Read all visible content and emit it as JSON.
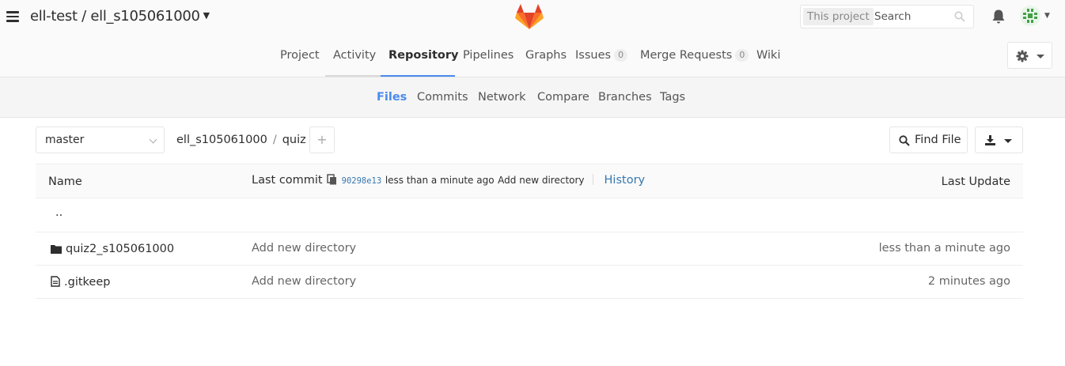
{
  "header": {
    "project_path": "ell-test / ell_s105061000",
    "search": {
      "scope": "This project",
      "placeholder": "Search"
    }
  },
  "nav": {
    "items": [
      {
        "label": "Project"
      },
      {
        "label": "Activity"
      },
      {
        "label": "Repository"
      },
      {
        "label": "Pipelines"
      },
      {
        "label": "Graphs"
      },
      {
        "label": "Issues",
        "count": "0"
      },
      {
        "label": "Merge Requests",
        "count": "0"
      },
      {
        "label": "Wiki"
      }
    ],
    "active": "Repository"
  },
  "subnav": {
    "items": [
      "Files",
      "Commits",
      "Network",
      "Compare",
      "Branches",
      "Tags"
    ],
    "active": "Files"
  },
  "controls": {
    "branch": "master",
    "breadcrumb": [
      "ell_s105061000",
      "quiz"
    ],
    "find_file": "Find File"
  },
  "table": {
    "headers": {
      "name": "Name",
      "last_commit": "Last commit",
      "last_update": "Last Update"
    },
    "commit": {
      "sha": "90298e13",
      "time": "less than a minute ago",
      "message": "Add new directory",
      "history": "History"
    },
    "parent_dir": "..",
    "rows": [
      {
        "type": "folder",
        "name": "quiz2_s105061000",
        "message": "Add new directory",
        "updated": "less than a minute ago"
      },
      {
        "type": "file",
        "name": ".gitkeep",
        "message": "Add new directory",
        "updated": "2 minutes ago"
      }
    ]
  },
  "colors": {
    "accent": "#4a8bee",
    "link": "#3777b0"
  }
}
